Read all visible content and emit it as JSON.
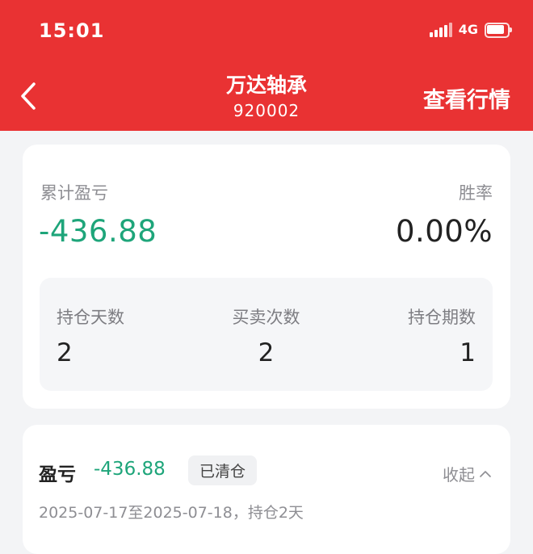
{
  "status_bar": {
    "time": "15:01",
    "network": "4G",
    "signal_icon": "signal-bars-icon",
    "battery_icon": "battery-icon"
  },
  "nav": {
    "title": "万达轴承",
    "code": "920002",
    "action": "查看行情",
    "back_icon": "chevron-left-icon"
  },
  "summary": {
    "cumulative_label": "累计盈亏",
    "cumulative_value": "-436.88",
    "win_rate_label": "胜率",
    "win_rate_value": "0.00%",
    "stats": [
      {
        "label": "持仓天数",
        "value": "2"
      },
      {
        "label": "买卖次数",
        "value": "2"
      },
      {
        "label": "持仓期数",
        "value": "1"
      }
    ]
  },
  "detail": {
    "pl_label": "盈亏",
    "pl_value": "-436.88",
    "status_badge": "已清仓",
    "collapse_label": "收起",
    "period": "2025-07-17至2025-07-18，持仓2天"
  },
  "colors": {
    "brand_red": "#e93233",
    "loss_green": "#1ea57a"
  }
}
